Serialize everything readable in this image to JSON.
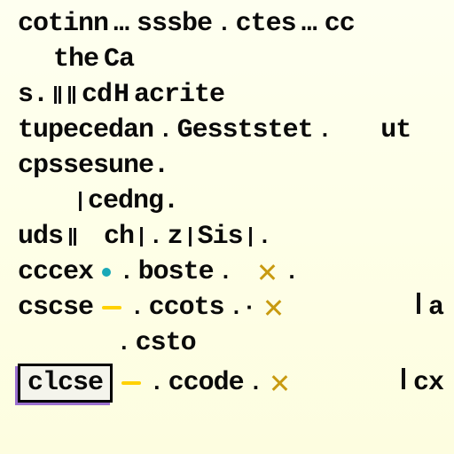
{
  "lines": {
    "l0": {
      "a": "cotinn",
      "b": "sssbe",
      "c": "ctes",
      "d": "cc"
    },
    "l1": {
      "a": "the",
      "b": "Ca"
    },
    "l2": {
      "a": "s.",
      "b": "cd",
      "c": "H",
      "d": "acrite"
    },
    "l3": {
      "a": "tupecedan",
      "b": "Gesststet",
      "c": "ut"
    },
    "l4": {
      "a": "cpssesune."
    },
    "l5": {
      "a": "cedng."
    },
    "l6": {
      "a": "uds",
      "b": "ch",
      "c": "z",
      "d": "Sis"
    },
    "l7": {
      "a": "cccex",
      "b": "boste",
      "c": "X"
    },
    "l8": {
      "a": "cscse",
      "b": "ccots",
      "c": "X",
      "d": "a"
    },
    "l9": {
      "a": "csto"
    },
    "l10": {
      "a": "clcse",
      "b": "ccode",
      "c": "X",
      "d": "cx"
    }
  }
}
